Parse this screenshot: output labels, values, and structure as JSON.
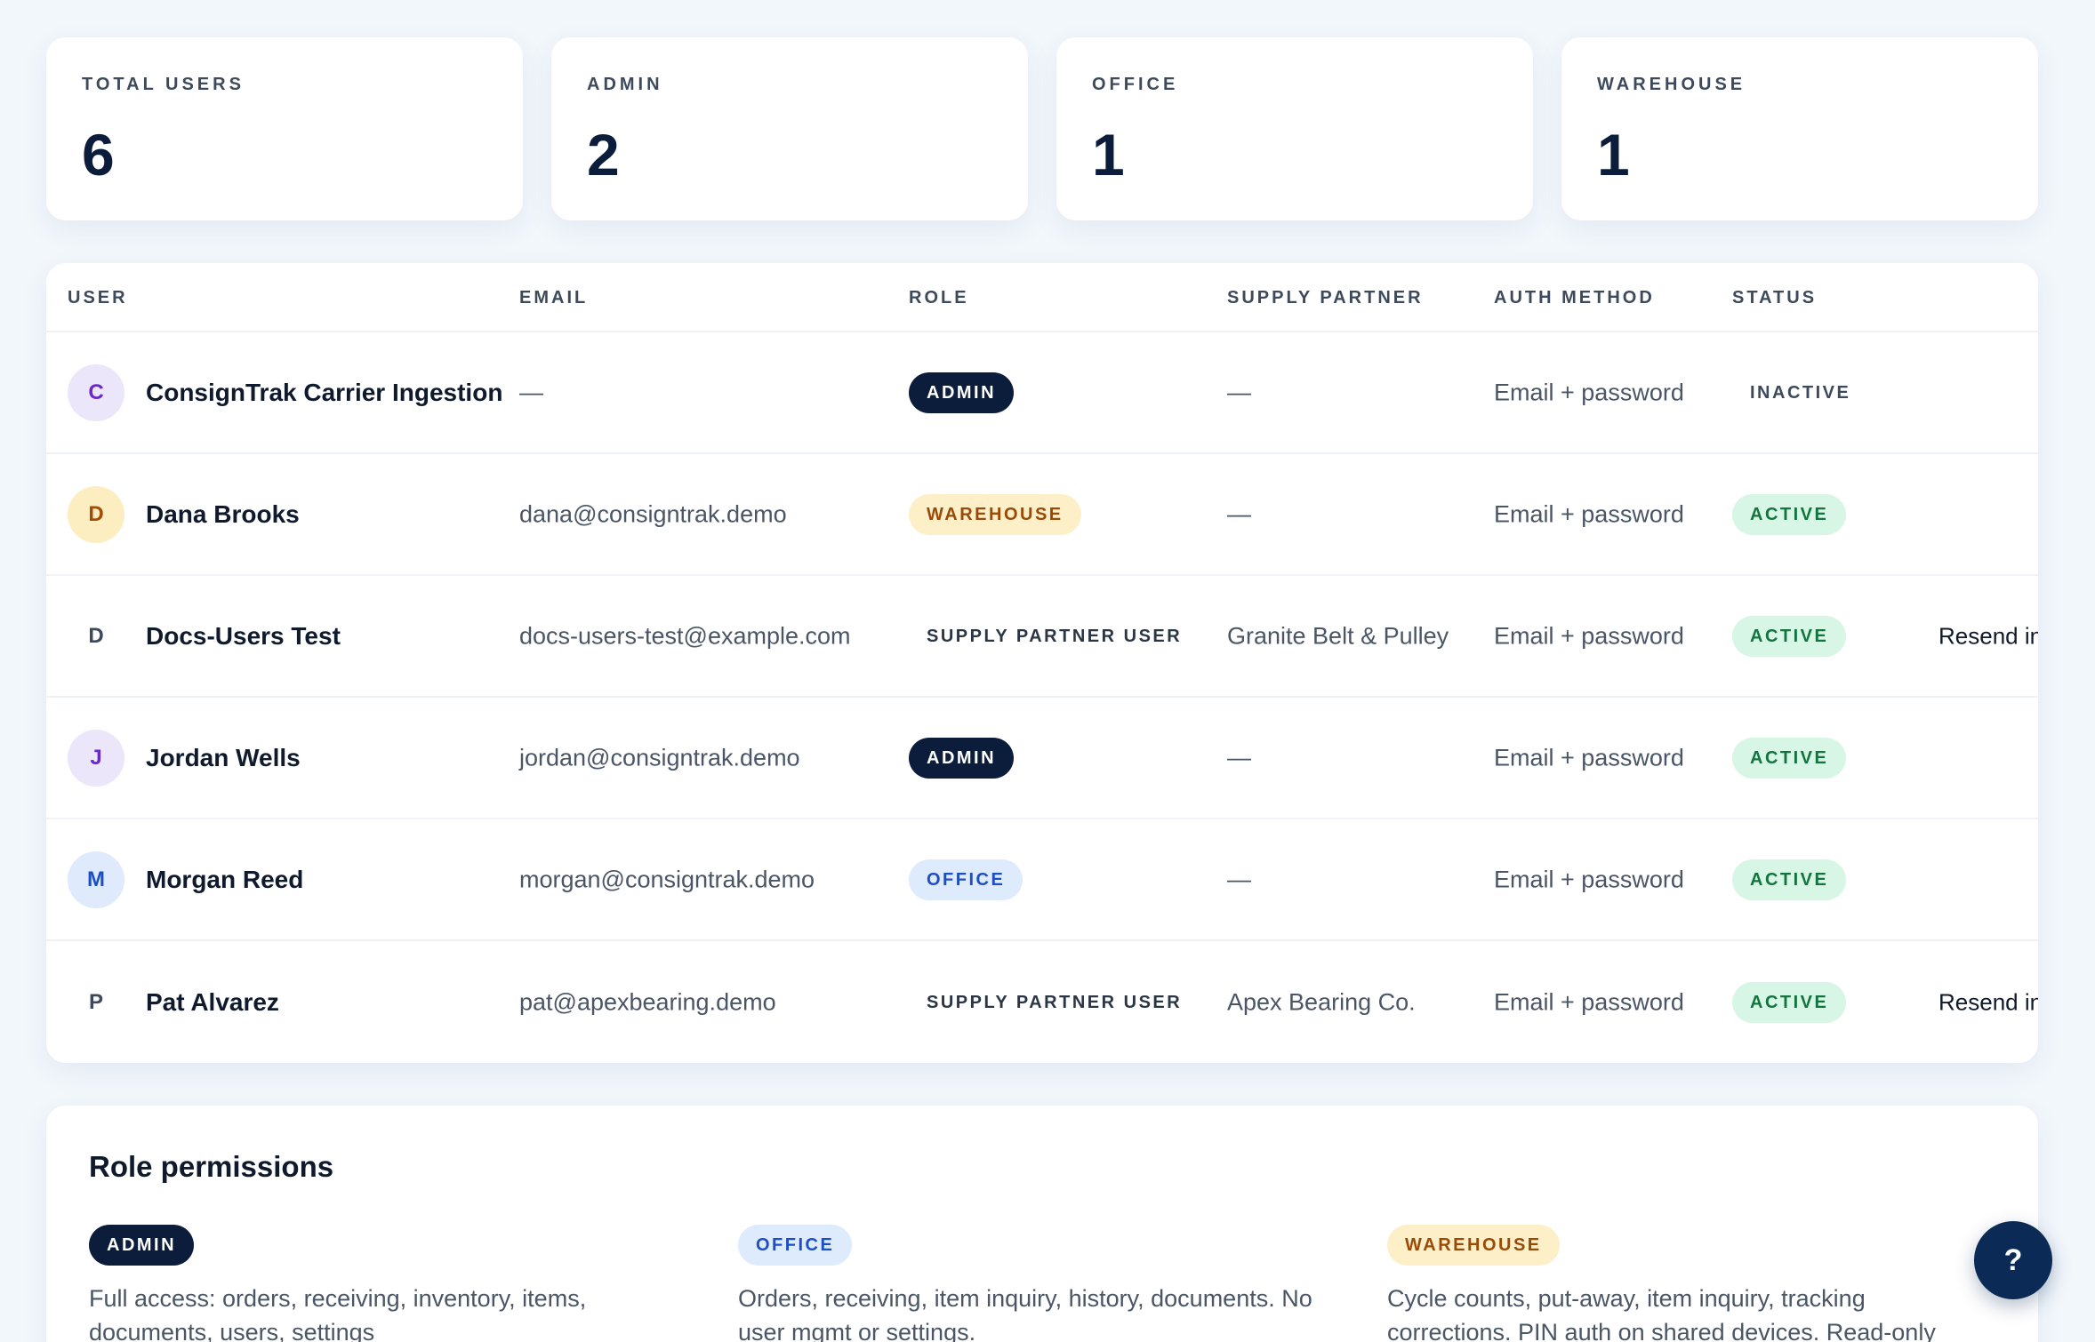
{
  "stats": [
    {
      "label": "TOTAL USERS",
      "value": "6"
    },
    {
      "label": "ADMIN",
      "value": "2"
    },
    {
      "label": "OFFICE",
      "value": "1"
    },
    {
      "label": "WAREHOUSE",
      "value": "1"
    }
  ],
  "table": {
    "headers": {
      "user": "USER",
      "email": "EMAIL",
      "role": "ROLE",
      "supply_partner": "SUPPLY PARTNER",
      "auth_method": "AUTH METHOD",
      "status": "STATUS"
    },
    "rows": [
      {
        "initial": "C",
        "name": "ConsignTrak Carrier Ingestion",
        "email": "—",
        "role": "ADMIN",
        "supply_partner": "—",
        "auth": "Email + password",
        "status": "INACTIVE",
        "action": ""
      },
      {
        "initial": "D",
        "name": "Dana Brooks",
        "email": "dana@consigntrak.demo",
        "role": "WAREHOUSE",
        "supply_partner": "—",
        "auth": "Email + password",
        "status": "ACTIVE",
        "action": ""
      },
      {
        "initial": "D",
        "name": "Docs-Users Test",
        "email": "docs-users-test@example.com",
        "role": "SUPPLY PARTNER USER",
        "supply_partner": "Granite Belt & Pulley",
        "auth": "Email + password",
        "status": "ACTIVE",
        "action": "Resend in"
      },
      {
        "initial": "J",
        "name": "Jordan Wells",
        "email": "jordan@consigntrak.demo",
        "role": "ADMIN",
        "supply_partner": "—",
        "auth": "Email + password",
        "status": "ACTIVE",
        "action": ""
      },
      {
        "initial": "M",
        "name": "Morgan Reed",
        "email": "morgan@consigntrak.demo",
        "role": "OFFICE",
        "supply_partner": "—",
        "auth": "Email + password",
        "status": "ACTIVE",
        "action": ""
      },
      {
        "initial": "P",
        "name": "Pat Alvarez",
        "email": "pat@apexbearing.demo",
        "role": "SUPPLY PARTNER USER",
        "supply_partner": "Apex Bearing Co.",
        "auth": "Email + password",
        "status": "ACTIVE",
        "action": "Resend in"
      }
    ]
  },
  "permissions": {
    "title": "Role permissions",
    "roles": [
      {
        "badge": "ADMIN",
        "description": "Full access: orders, receiving, inventory, items, documents, users, settings"
      },
      {
        "badge": "OFFICE",
        "description": "Orders, receiving, item inquiry, history, documents. No user mgmt or settings."
      },
      {
        "badge": "WAREHOUSE",
        "description": "Cycle counts, put-away, item inquiry, tracking corrections. PIN auth on shared devices. Read-only"
      }
    ]
  },
  "help": {
    "label": "?"
  },
  "colors": {
    "background": "#f2f7fc",
    "navy": "#0b1d3a",
    "active_green": "#13743f",
    "warehouse_amber": "#9a4a07",
    "office_blue": "#1d4fc4"
  }
}
